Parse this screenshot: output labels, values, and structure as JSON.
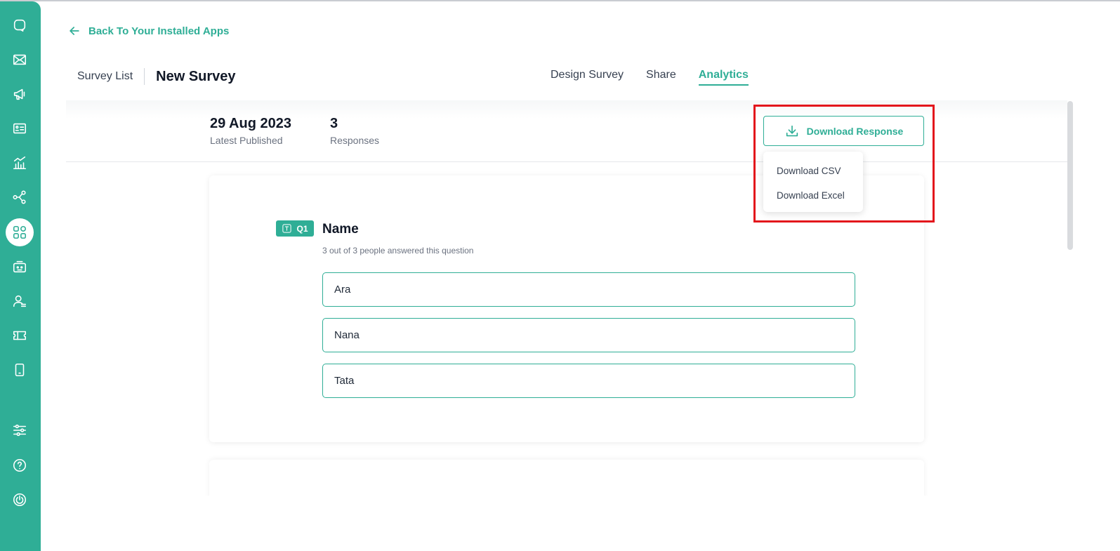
{
  "nav": {
    "back_label": "Back To Your Installed Apps"
  },
  "breadcrumb": {
    "list_label": "Survey List",
    "title": "New Survey"
  },
  "tabs": [
    {
      "label": "Design Survey",
      "active": false
    },
    {
      "label": "Share",
      "active": false
    },
    {
      "label": "Analytics",
      "active": true
    }
  ],
  "stats": {
    "published_value": "29 Aug 2023",
    "published_label": "Latest Published",
    "responses_value": "3",
    "responses_label": "Responses"
  },
  "download": {
    "button_label": "Download Response",
    "options": [
      "Download CSV",
      "Download Excel"
    ]
  },
  "question": {
    "badge": "Q1",
    "title": "Name",
    "subtitle": "3 out of 3 people answered this question",
    "answers": [
      "Ara",
      "Nana",
      "Tata"
    ]
  },
  "sidebar": {
    "icons": [
      "chat-icon",
      "mail-icon",
      "megaphone-icon",
      "contact-card-icon",
      "analytics-icon",
      "share-flow-icon",
      "apps-icon",
      "bot-icon",
      "user-list-icon",
      "ticket-icon",
      "mobile-icon",
      "settings-sliders-icon",
      "help-icon",
      "power-icon"
    ],
    "active": "apps-icon"
  },
  "colors": {
    "accent": "#2fae96",
    "highlight": "#e3161c"
  }
}
